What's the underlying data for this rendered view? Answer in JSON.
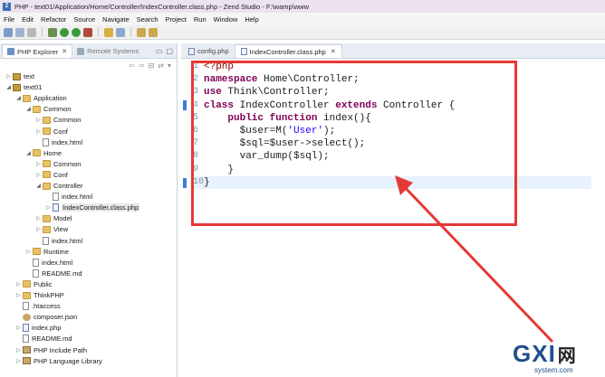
{
  "window": {
    "title": "PHP - text01/Application/Home/Controller/IndexController.class.php - Zend Studio - F:\\wamp\\www"
  },
  "menu": {
    "items": [
      "File",
      "Edit",
      "Refactor",
      "Source",
      "Navigate",
      "Search",
      "Project",
      "Run",
      "Window",
      "Help"
    ]
  },
  "left_panel": {
    "tabs": [
      {
        "label": "PHP Explorer",
        "active": true
      },
      {
        "label": "Remote Systems",
        "active": false
      }
    ],
    "tree": [
      {
        "label": "text",
        "depth": 0,
        "icon": "project-icon",
        "twisty": "▷"
      },
      {
        "label": "text01",
        "depth": 0,
        "icon": "project-icon",
        "twisty": "◢"
      },
      {
        "label": "Application",
        "depth": 1,
        "icon": "folder-icon",
        "twisty": "◢"
      },
      {
        "label": "Common",
        "depth": 2,
        "icon": "folder-icon",
        "twisty": "◢"
      },
      {
        "label": "Common",
        "depth": 3,
        "icon": "folder-icon",
        "twisty": "▷"
      },
      {
        "label": "Conf",
        "depth": 3,
        "icon": "folder-icon",
        "twisty": "▷"
      },
      {
        "label": "index.html",
        "depth": 3,
        "icon": "file-icon",
        "twisty": ""
      },
      {
        "label": "Home",
        "depth": 2,
        "icon": "folder-icon",
        "twisty": "◢"
      },
      {
        "label": "Common",
        "depth": 3,
        "icon": "folder-icon",
        "twisty": "▷"
      },
      {
        "label": "Conf",
        "depth": 3,
        "icon": "folder-icon",
        "twisty": "▷"
      },
      {
        "label": "Controller",
        "depth": 3,
        "icon": "folder-icon",
        "twisty": "◢"
      },
      {
        "label": "index.html",
        "depth": 4,
        "icon": "file-icon",
        "twisty": ""
      },
      {
        "label": "IndexController.class.php",
        "depth": 4,
        "icon": "php-file-icon",
        "twisty": "▷",
        "selected": true
      },
      {
        "label": "Model",
        "depth": 3,
        "icon": "folder-icon",
        "twisty": "▷"
      },
      {
        "label": "View",
        "depth": 3,
        "icon": "folder-icon",
        "twisty": "▷"
      },
      {
        "label": "index.html",
        "depth": 3,
        "icon": "file-icon",
        "twisty": ""
      },
      {
        "label": "Runtime",
        "depth": 2,
        "icon": "folder-icon",
        "twisty": "▷"
      },
      {
        "label": "index.html",
        "depth": 2,
        "icon": "file-icon",
        "twisty": ""
      },
      {
        "label": "README.md",
        "depth": 2,
        "icon": "file-icon",
        "twisty": ""
      },
      {
        "label": "Public",
        "depth": 1,
        "icon": "folder-icon",
        "twisty": "▷"
      },
      {
        "label": "ThinkPHP",
        "depth": 1,
        "icon": "folder-icon",
        "twisty": "▷"
      },
      {
        "label": ".htaccess",
        "depth": 1,
        "icon": "file-icon",
        "twisty": ""
      },
      {
        "label": "composer.json",
        "depth": 1,
        "icon": "json-file-icon",
        "twisty": ""
      },
      {
        "label": "index.php",
        "depth": 1,
        "icon": "php-file-icon",
        "twisty": "▷"
      },
      {
        "label": "README.md",
        "depth": 1,
        "icon": "file-icon",
        "twisty": ""
      },
      {
        "label": "PHP Include Path",
        "depth": 1,
        "icon": "library-icon",
        "twisty": "▷"
      },
      {
        "label": "PHP Language Library",
        "depth": 1,
        "icon": "library-icon",
        "twisty": "▷"
      }
    ]
  },
  "editor": {
    "tabs": [
      {
        "label": "config.php",
        "active": false
      },
      {
        "label": "IndexController.class.php",
        "active": true
      }
    ],
    "lines": [
      {
        "n": "1",
        "tokens": [
          {
            "t": "<?php",
            "c": "tagc"
          }
        ]
      },
      {
        "n": "2",
        "tokens": [
          {
            "t": "namespace",
            "c": "kw"
          },
          {
            "t": " Home\\Controller;",
            "c": "var"
          }
        ]
      },
      {
        "n": "3",
        "tokens": [
          {
            "t": "use",
            "c": "kw"
          },
          {
            "t": " Think\\Controller;",
            "c": "var"
          }
        ]
      },
      {
        "n": "4",
        "tokens": [
          {
            "t": "class",
            "c": "kw"
          },
          {
            "t": " IndexController ",
            "c": "var"
          },
          {
            "t": "extends",
            "c": "kw"
          },
          {
            "t": " Controller {",
            "c": "var"
          }
        ]
      },
      {
        "n": "5",
        "tokens": [
          {
            "t": "    ",
            "c": "var"
          },
          {
            "t": "public",
            "c": "kw"
          },
          {
            "t": " ",
            "c": "var"
          },
          {
            "t": "function",
            "c": "kw"
          },
          {
            "t": " index(){",
            "c": "var"
          }
        ]
      },
      {
        "n": "6",
        "tokens": [
          {
            "t": "      $user=M(",
            "c": "var"
          },
          {
            "t": "'User'",
            "c": "str"
          },
          {
            "t": ");",
            "c": "var"
          }
        ]
      },
      {
        "n": "7",
        "tokens": [
          {
            "t": "      $sql=$user->select();",
            "c": "var"
          }
        ]
      },
      {
        "n": "8",
        "tokens": [
          {
            "t": "      var_dump($sql);",
            "c": "var"
          }
        ]
      },
      {
        "n": "9",
        "tokens": [
          {
            "t": "    }",
            "c": "var"
          }
        ]
      },
      {
        "n": "10",
        "tokens": [
          {
            "t": "}",
            "c": "var"
          }
        ]
      }
    ]
  },
  "watermark": {
    "logo": "GXI",
    "logo_cn": "网",
    "domain": "system.com"
  }
}
